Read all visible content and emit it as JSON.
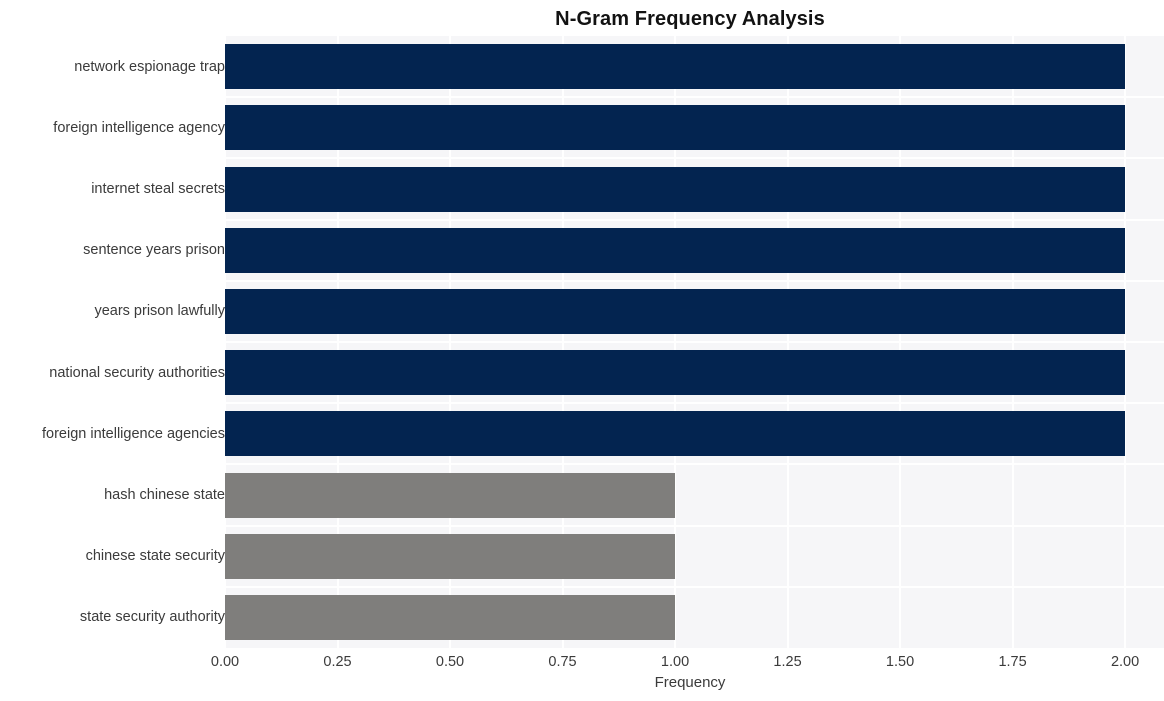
{
  "chart_data": {
    "type": "bar",
    "orientation": "horizontal",
    "title": "N-Gram Frequency Analysis",
    "xlabel": "Frequency",
    "ylabel": "",
    "xlim": [
      0.0,
      2.0865
    ],
    "grid": true,
    "legend": null,
    "xticks": [
      "0.00",
      "0.25",
      "0.50",
      "0.75",
      "1.00",
      "1.25",
      "1.50",
      "1.75",
      "2.00"
    ],
    "xtick_values": [
      0.0,
      0.25,
      0.5,
      0.75,
      1.0,
      1.25,
      1.5,
      1.75,
      2.0
    ],
    "categories": [
      "network espionage trap",
      "foreign intelligence agency",
      "internet steal secrets",
      "sentence years prison",
      "years prison lawfully",
      "national security authorities",
      "foreign intelligence agencies",
      "hash chinese state",
      "chinese state security",
      "state security authority"
    ],
    "values": [
      2,
      2,
      2,
      2,
      2,
      2,
      2,
      1,
      1,
      1
    ],
    "bar_colors": [
      "#032450",
      "#032450",
      "#032450",
      "#032450",
      "#032450",
      "#032450",
      "#032450",
      "#7f7e7c",
      "#7f7e7c",
      "#7f7e7c"
    ],
    "colors": {
      "primary": "#032450",
      "secondary": "#7f7e7c",
      "plot_background": "#f6f6f8",
      "figure_background": "#ffffff",
      "gridline": "#ffffff",
      "title_text": "#121212",
      "tick_text": "#3b3b3b"
    }
  }
}
